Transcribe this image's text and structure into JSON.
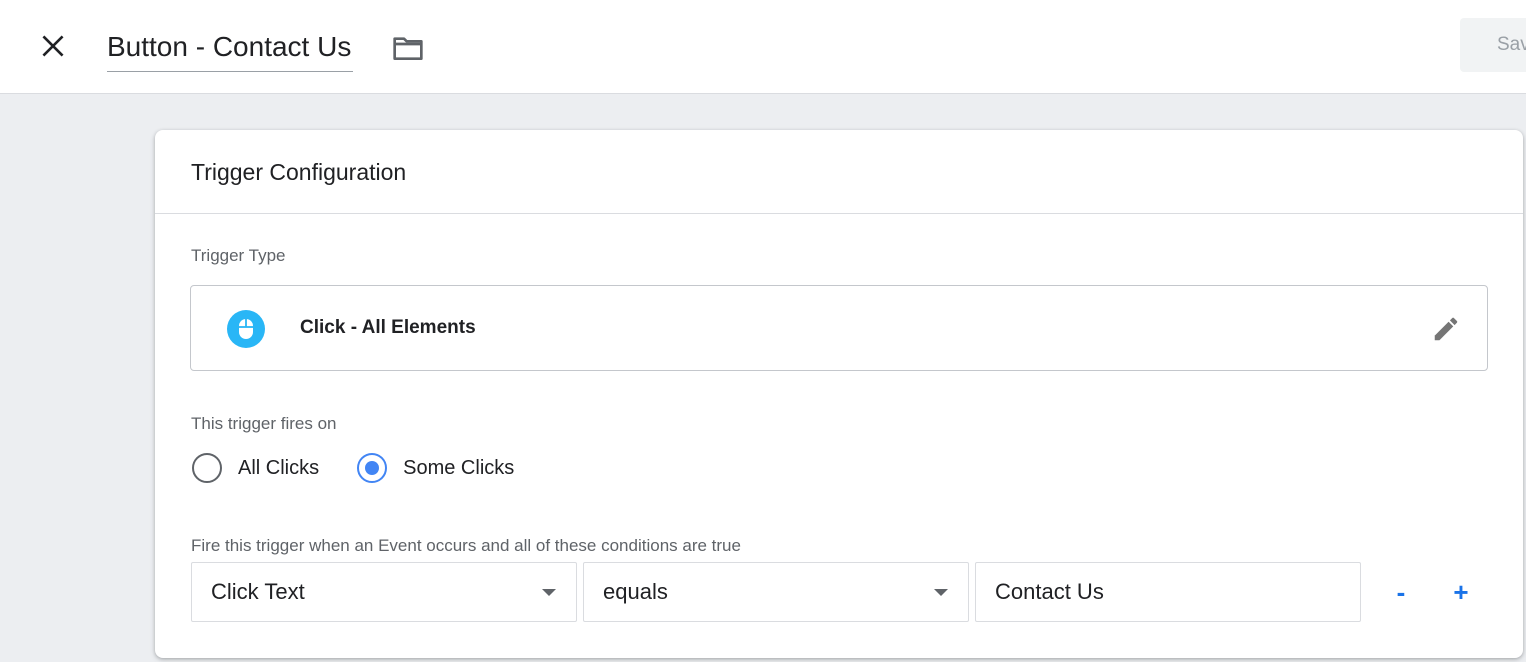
{
  "header": {
    "title": "Button - Contact Us",
    "save_label": "Save"
  },
  "card": {
    "title": "Trigger Configuration",
    "trigger_type_label": "Trigger Type",
    "trigger_type_value": "Click - All Elements",
    "fires_on_label": "This trigger fires on",
    "fires_on_options": [
      {
        "label": "All Clicks",
        "checked": false
      },
      {
        "label": "Some Clicks",
        "checked": true
      }
    ],
    "condition_label": "Fire this trigger when an Event occurs and all of these conditions are true",
    "condition": {
      "variable": "Click Text",
      "operator": "equals",
      "value": "Contact Us",
      "remove_label": "-",
      "add_label": "+"
    }
  },
  "colors": {
    "accent": "#4285f4",
    "icon_blue": "#29b6f6",
    "link_blue": "#1a73e8"
  },
  "icons": [
    "close-icon",
    "folder-icon",
    "mouse-icon",
    "pencil-icon"
  ]
}
